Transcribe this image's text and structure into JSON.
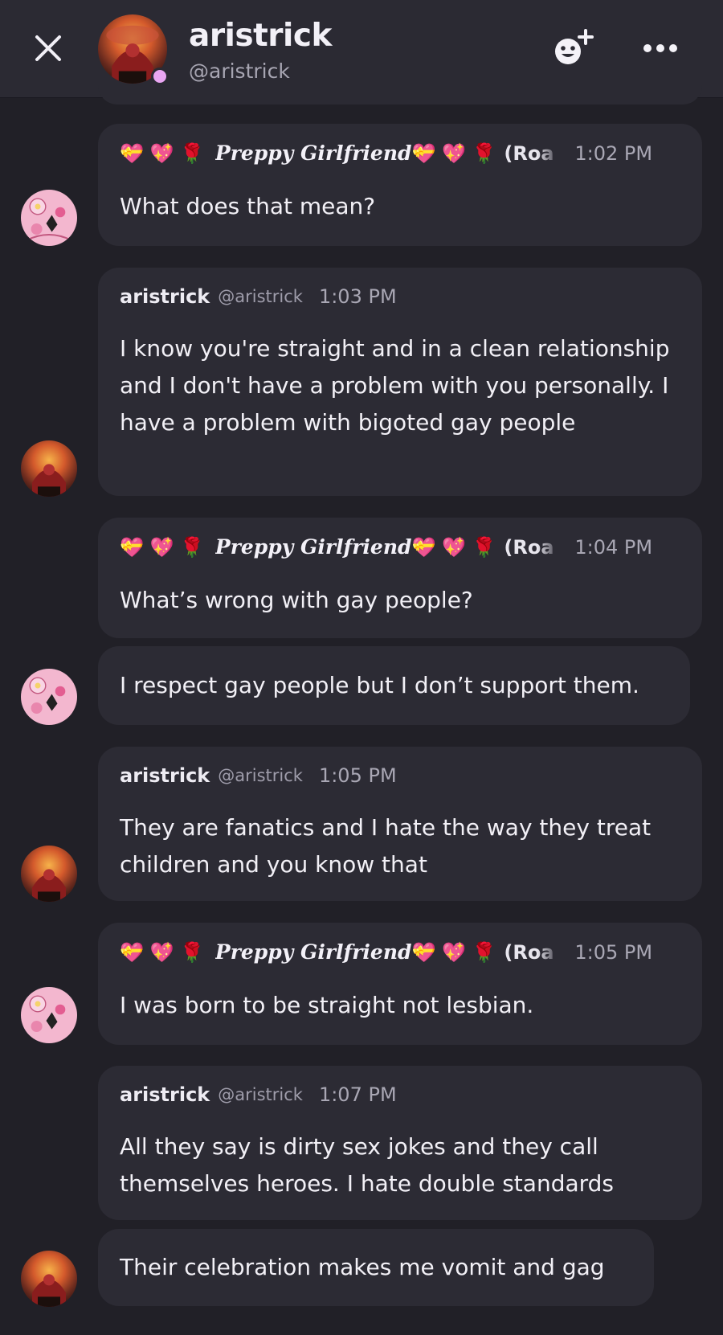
{
  "header": {
    "name": "aristrick",
    "handle": "@aristrick",
    "status_color": "#e9a6f2",
    "close_icon": "close-icon",
    "add_friend_icon": "add-friend-icon",
    "more_icon": "more-icon"
  },
  "messages": [
    {
      "author_display": "Preppy Girlfriend",
      "emoji_prefix": "💝 💖 🌹",
      "emoji_suffix": "💝 💖 🌹",
      "author_extra": "(Roa",
      "time": "1:02 PM",
      "text": "What does that mean?"
    },
    {
      "author": "aristrick",
      "handle": "@aristrick",
      "time": "1:03 PM",
      "text": "I know you're straight and in a clean relationship and I don't have a problem with you personally. I have a problem with bigoted gay people"
    },
    {
      "author_display": "Preppy Girlfriend",
      "emoji_prefix": "💝 💖 🌹",
      "emoji_suffix": "💝 💖 🌹",
      "author_extra": "(Roa",
      "time": "1:04 PM",
      "text": "What’s wrong with gay people?"
    },
    {
      "text": "I respect gay people but I don’t support them."
    },
    {
      "author": "aristrick",
      "handle": "@aristrick",
      "time": "1:05 PM",
      "text": "They are fanatics and I hate the way they treat children and you know that"
    },
    {
      "author_display": "Preppy Girlfriend",
      "emoji_prefix": "💝 💖 🌹",
      "emoji_suffix": "💝 💖 🌹",
      "author_extra": "(Roa",
      "time": "1:05 PM",
      "text": "I was born to be straight not lesbian."
    },
    {
      "author": "aristrick",
      "handle": "@aristrick",
      "time": "1:07 PM",
      "text": "All they say is dirty sex jokes and they call themselves heroes. I hate double standards"
    },
    {
      "text": "Their celebration makes me vomit and gag"
    }
  ]
}
